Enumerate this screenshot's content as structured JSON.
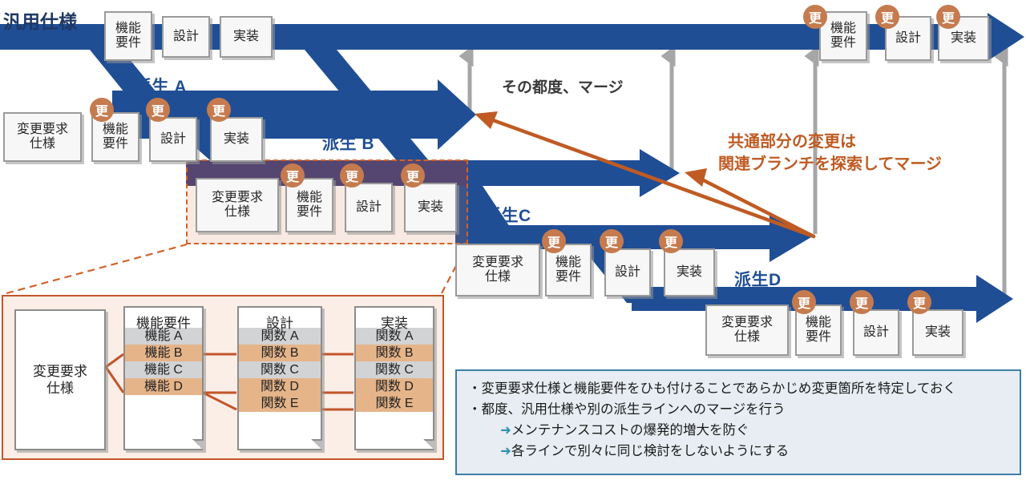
{
  "meta": {
    "colors": {
      "branch_blue": "#1F4E95",
      "branch_blue_dark": "#3C3C78",
      "badge_orange": "#C57B4E",
      "accent_orange": "#BF5B23",
      "highlight_fill": "#F2DFD2",
      "gray_arrow": "#A6A6A6",
      "legend_bg": "#E7EDF2",
      "legend_border": "#3E7EA6",
      "detail_border": "#C2552A",
      "detail_bg": "#FAEEE6",
      "row_gray": "#D2D3D5",
      "row_orange": "#E5B489"
    },
    "badge_label": "更"
  },
  "branches": [
    {
      "id": "main",
      "label": "汎用仕様",
      "cards_left": [
        "機能\n要件",
        "設計",
        "実装"
      ],
      "cards_right": [
        "機能\n要件",
        "設計",
        "実装"
      ],
      "right_badges": [
        "更",
        "更",
        "更"
      ]
    },
    {
      "id": "a",
      "label": "派生 A",
      "cards": [
        "変更要求\n仕様",
        "機能\n要件",
        "設計",
        "実装"
      ],
      "badges": [
        "更",
        "更",
        "更"
      ]
    },
    {
      "id": "b",
      "label": "派生 B",
      "cards": [
        "変更要求\n仕様",
        "機能\n要件",
        "設計",
        "実装"
      ],
      "badges": [
        "更",
        "更",
        "更"
      ]
    },
    {
      "id": "c",
      "label": "派生C",
      "cards": [
        "変更要求\n仕様",
        "機能\n要件",
        "設計",
        "実装"
      ],
      "badges": [
        "更",
        "更",
        "更"
      ]
    },
    {
      "id": "d",
      "label": "派生D",
      "cards": [
        "変更要求\n仕様",
        "機能\n要件",
        "設計",
        "実装"
      ],
      "badges": [
        "更",
        "更",
        "更"
      ]
    }
  ],
  "annotations": {
    "merge_each_time": "その都度、マージ",
    "common_change_line1": "共通部分の変更は",
    "common_change_line2": "関連ブランチを探索してマージ"
  },
  "detail": {
    "spec_card": "変更要求\n仕様",
    "columns": [
      {
        "header": "機能要件",
        "rows": [
          {
            "label": "機能 A",
            "style": "gray"
          },
          {
            "label": "機能 B",
            "style": "orange"
          },
          {
            "label": "機能 C",
            "style": "gray"
          },
          {
            "label": "機能 D",
            "style": "orange"
          }
        ]
      },
      {
        "header": "設計",
        "rows": [
          {
            "label": "関数 A",
            "style": "gray"
          },
          {
            "label": "関数 B",
            "style": "orange"
          },
          {
            "label": "関数 C",
            "style": "gray"
          },
          {
            "label": "関数 D",
            "style": "orange"
          },
          {
            "label": "関数 E",
            "style": "orange"
          }
        ]
      },
      {
        "header": "実装",
        "rows": [
          {
            "label": "関数 A",
            "style": "gray"
          },
          {
            "label": "関数 B",
            "style": "orange"
          },
          {
            "label": "関数 C",
            "style": "gray"
          },
          {
            "label": "関数 D",
            "style": "orange"
          },
          {
            "label": "関数 E",
            "style": "orange"
          }
        ]
      }
    ]
  },
  "legend": {
    "bullet1": "・変更要求仕様と機能要件をひも付けることであらかじめ変更箇所を特定しておく",
    "bullet2": "・都度、汎用仕様や別の派生ラインへのマージを行う",
    "sub1_arrow": "➜",
    "sub1": "メンテナンスコストの爆発的増大を防ぐ",
    "sub2_arrow": "➜",
    "sub2": "各ラインで別々に同じ検討をしないようにする"
  }
}
